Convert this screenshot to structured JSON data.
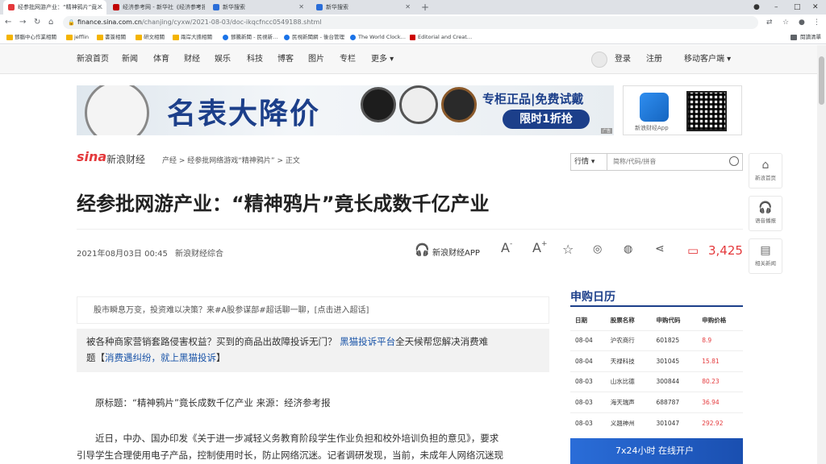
{
  "browser": {
    "tabs": [
      {
        "title": "经参批网游产业：“精神鸦片”竟…",
        "active": true,
        "favicon_color": "#e4393c"
      },
      {
        "title": "经济参考网 - 新华社《经济参考报…",
        "active": false,
        "favicon_color": "#c00000"
      },
      {
        "title": "新华搜索",
        "active": false,
        "favicon_color": "#2a6dd8"
      },
      {
        "title": "新华搜索",
        "active": false,
        "favicon_color": "#2a6dd8"
      }
    ],
    "new_tab": "+",
    "window_controls": [
      "●",
      "–",
      "□",
      "✕"
    ],
    "url_host": "finance.sina.com.cn",
    "url_path": "/chanjing/cyxw/2021-08-03/doc-ikqcfncc0549188.shtml",
    "bookmarks": [
      {
        "label": "鄧腦中心作業相關",
        "type": "folder"
      },
      {
        "label": "jefflin",
        "type": "folder"
      },
      {
        "label": "書簽相關",
        "type": "folder"
      },
      {
        "label": "研文相關",
        "type": "folder"
      },
      {
        "label": "兩岸大擔相關",
        "type": "folder"
      },
      {
        "label": "鄧騰新聞 - 民視新…",
        "type": "site"
      },
      {
        "label": "民視新聞網 - 後台管理",
        "type": "site"
      },
      {
        "label": "The World Clock…",
        "type": "site"
      },
      {
        "label": "Editorial and Creat…",
        "type": "site"
      }
    ],
    "reading_list": "閱讀清單"
  },
  "nav": {
    "items": [
      "新浪首页",
      "新闻",
      "体育",
      "财经",
      "娱乐",
      "科技",
      "博客",
      "图片",
      "专栏",
      "更多 ▾"
    ],
    "login": "登录",
    "register": "注册",
    "mobile": "移动客户端 ▾"
  },
  "banner": {
    "title": "名表大降价",
    "subtitle": "专柜正品|免费试戴",
    "button": "限时1折抢",
    "ad_tag": "广告"
  },
  "app_promo": {
    "name": "新浪财经App"
  },
  "header": {
    "logo": "sina",
    "logo_sub": "新浪财经",
    "breadcrumb": "产经 > 经参批网络游戏“精神鸦片” > 正文",
    "search_select": "行情 ▾",
    "search_placeholder": "简称/代码/拼音"
  },
  "article": {
    "title": "经参批网游产业：“精神鸦片”竟长成数千亿产业",
    "date": "2021年08月03日 00:45",
    "source": "新浪财经综合",
    "app_link": "新浪财经APP",
    "comment_count": "3,425",
    "notice": "股市瞬息万变，投资难以决策？来#A股参谋部#超话聊一聊，[点击进入超话]",
    "promo_line1_a": "被各种商家营销套路侵害权益？买到的商品出故障投诉无门？",
    "promo_line1_b": "黑猫投诉平台",
    "promo_line1_c": "全天候帮您解决消费难",
    "promo_line2_a": "题【",
    "promo_line2_b": "消费遇纠纷，就上黑猫投诉",
    "promo_line2_c": "】",
    "orig_title": "原标题：“精神鸦片”竟长成数千亿产业  来源：经济参考报",
    "para1": "近日，中办、国办印发《关于进一步减轻义务教育阶段学生作业负担和校外培训负担的意见》，要求",
    "para2": "引导学生合理使用电子产品，控制使用时长，防止网络沉迷。记者调研发现，当前，未成年人网络沉迷现"
  },
  "side_buttons": [
    {
      "label": "新浪首页",
      "icon": "home-icon"
    },
    {
      "label": "语音播报",
      "icon": "headphones-icon"
    },
    {
      "label": "相关新闻",
      "icon": "document-icon"
    }
  ],
  "ipo": {
    "title": "申购日历",
    "headers": [
      "日期",
      "股票名称",
      "申购代码",
      "申购价格"
    ],
    "rows": [
      [
        "08-04",
        "沪农商行",
        "601825",
        "8.9"
      ],
      [
        "08-04",
        "天禄科技",
        "301045",
        "15.81"
      ],
      [
        "08-03",
        "山水比德",
        "300844",
        "80.23"
      ],
      [
        "08-03",
        "海天瑞声",
        "688787",
        "36.94"
      ],
      [
        "08-03",
        "义翘神州",
        "301047",
        "292.92"
      ]
    ]
  },
  "live_banner": "7x24小时 在线开户"
}
